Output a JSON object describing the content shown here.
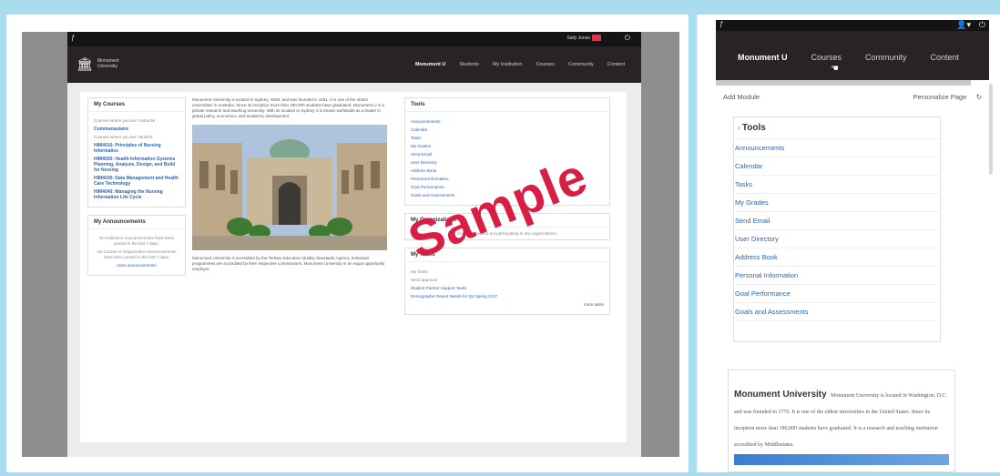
{
  "colors": {
    "accent": "#2a64b8",
    "nav_bg": "#2a2323",
    "watermark": "#d81f43",
    "badge": "#d43a4f"
  },
  "desktop": {
    "topbar": {
      "logo_icon": "f-icon",
      "user": "Sally Jones",
      "power_icon": "power-icon"
    },
    "institution": {
      "icon": "institution-icon",
      "name": "Monument University"
    },
    "nav": [
      "Monument U",
      "Students",
      "My Institution",
      "Courses",
      "Community",
      "Content"
    ],
    "my_courses": {
      "title": "My Courses",
      "intro": "Courses where you are: Instructor",
      "community": "Communautaire",
      "student_label": "Courses where you are: Student",
      "courses": [
        "HIM4010: Principles of Nursing Informatics",
        "HIM4020: Health Information Systems Planning, Analysis, Design, and Build for Nursing",
        "HIM4030: Data Management and Health Care Technology",
        "HIM4040: Managing the Nursing Information Life Cycle"
      ]
    },
    "my_announcements": {
      "title": "My Announcements",
      "line1": "No Institution Announcements have been posted in the last 7 days.",
      "line2": "No Course or Organization Announcements have been posted in the last 7 days.",
      "link": "more announcements"
    },
    "about_text": "Monument University is located in Sydney, NSW, and was founded in 1831. It is one of the oldest universities in Australia. Since its inception more than 180,000 students have graduated. Monument U is a private research and teaching university. With its location in Sydney, it is known worldwide as a leader in global policy, economics, and academic development.",
    "caption": "Monument University is accredited by the Tertiary Education Quality Standards Agency. Individual programmes are accredited by their respective commissions. Monument University is an equal opportunity employer.",
    "tools": {
      "title": "Tools",
      "items": [
        "Announcements",
        "Calendar",
        "Tasks",
        "My Grades",
        "Send Email",
        "User Directory",
        "Address Book",
        "Personal Information",
        "Goal Performance",
        "Goals and Assessments"
      ]
    },
    "my_organizations": {
      "title": "My Organizations",
      "text": "Currently you are not participating in any organizations."
    },
    "my_tasks": {
      "title": "My Tasks",
      "items": [
        "My Tasks",
        "Send approval",
        "Student Partner Support Tasks",
        "Demographic Report Needs for Q4 Spring 2017"
      ],
      "link": "more tasks"
    },
    "watermark": "Sample"
  },
  "mobile": {
    "topbar": {
      "logo_icon": "f-icon",
      "user_icon": "user-icon",
      "power_icon": "power-icon"
    },
    "tabs": [
      "Monument U",
      "Courses",
      "Community",
      "Content"
    ],
    "add_module": "Add Module",
    "personalize": "Personalize Page",
    "refresh_icon": "refresh-icon",
    "tools": {
      "title": "Tools",
      "items": [
        "Announcements",
        "Calendar",
        "Tasks",
        "My Grades",
        "Send Email",
        "User Directory",
        "Address Book",
        "Personal Information",
        "Goal Performance",
        "Goals and Assessments"
      ]
    },
    "about": {
      "title": "Monument University",
      "text": "Monument University is located in Washington, D.C. and was founded in 1770. It is one of the oldest universities in the United States. Since its inception more than 180,000 students have graduated. It is a research and teaching institution accredited by Middlestates."
    }
  }
}
